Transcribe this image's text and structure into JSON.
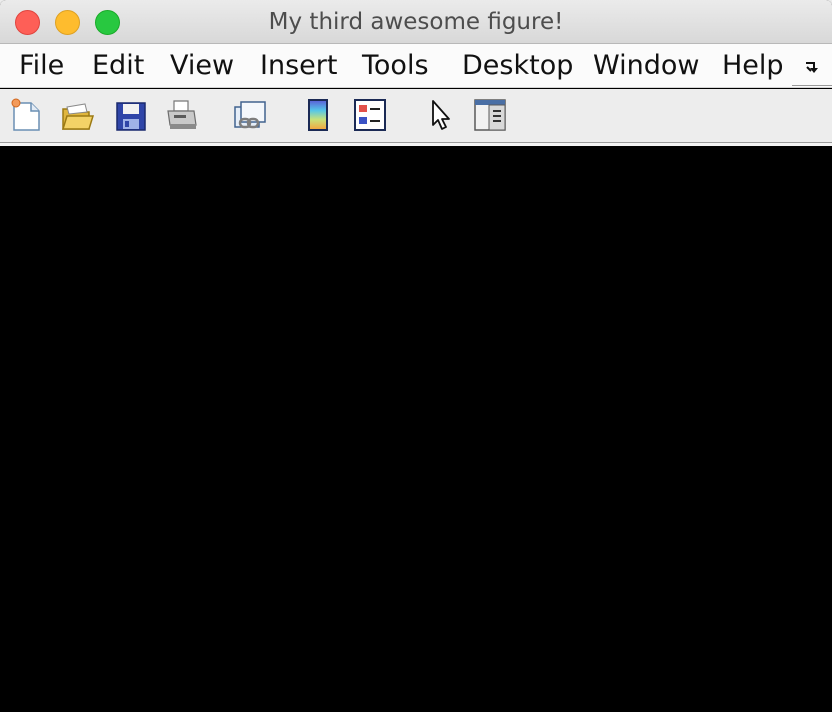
{
  "window": {
    "title": "My third awesome figure!"
  },
  "menubar": {
    "items": [
      {
        "label": "File"
      },
      {
        "label": "Edit"
      },
      {
        "label": "View"
      },
      {
        "label": "Insert"
      },
      {
        "label": "Tools"
      },
      {
        "label": "Desktop"
      },
      {
        "label": "Window"
      },
      {
        "label": "Help"
      }
    ],
    "overflow_icon": "menu-overflow-icon"
  },
  "toolbar": {
    "tools": [
      {
        "name": "new-figure-icon"
      },
      {
        "name": "open-file-icon"
      },
      {
        "name": "save-figure-icon"
      },
      {
        "name": "print-figure-icon"
      },
      {
        "name": "link-plot-icon"
      },
      {
        "name": "insert-colorbar-icon"
      },
      {
        "name": "insert-legend-icon"
      },
      {
        "name": "edit-plot-icon"
      },
      {
        "name": "open-property-inspector-icon"
      }
    ]
  },
  "colors": {
    "canvas_background": "#000000",
    "close": "#fe5f57",
    "minimize": "#febc2e",
    "zoom": "#28c840"
  }
}
